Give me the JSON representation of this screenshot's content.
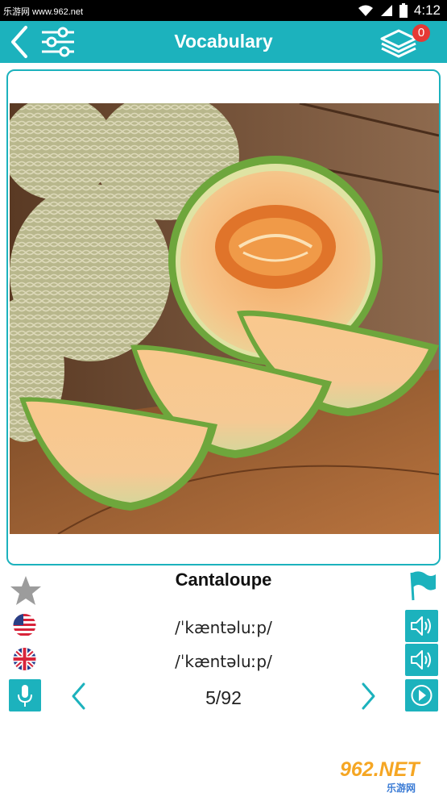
{
  "status_bar": {
    "watermark": "乐游网 www.962.net",
    "time": "4:12"
  },
  "toolbar": {
    "title": "Vocabulary",
    "badge_count": "0"
  },
  "card": {
    "word": "Cantaloupe",
    "pronunciation_us": "/ˈkæntəluːp/",
    "pronunciation_uk": "/ˈkæntəluːp/"
  },
  "navigation": {
    "counter": "5/92"
  },
  "watermark": {
    "top": "962.NET",
    "bottom": "乐游网"
  },
  "colors": {
    "accent": "#1cb2bd",
    "badge": "#e53935"
  },
  "icons": {
    "back": "chevron-left-icon",
    "settings": "sliders-icon",
    "deck": "layers-icon",
    "favorite": "star-icon",
    "report": "flag-icon",
    "us_flag": "us-flag-icon",
    "uk_flag": "uk-flag-icon",
    "speaker": "speaker-icon",
    "mic": "microphone-icon",
    "prev": "chevron-left-icon",
    "next": "chevron-right-icon",
    "play": "play-icon"
  }
}
